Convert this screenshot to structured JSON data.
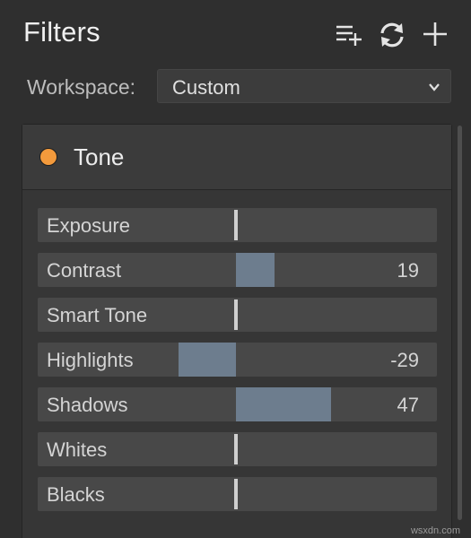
{
  "panel": {
    "title": "Filters",
    "icons": {
      "add_to_list": "playlist-add-icon",
      "sync": "sync-icon",
      "add": "plus-icon"
    }
  },
  "workspace": {
    "label": "Workspace:",
    "value": "Custom",
    "icon": "chevron-down-icon"
  },
  "section": {
    "title": "Tone",
    "indicator_color": "#f39a3c",
    "sliders": [
      {
        "label": "Exposure",
        "value": ""
      },
      {
        "label": "Contrast",
        "value": "19"
      },
      {
        "label": "Smart Tone",
        "value": ""
      },
      {
        "label": "Highlights",
        "value": "-29"
      },
      {
        "label": "Shadows",
        "value": "47"
      },
      {
        "label": "Whites",
        "value": ""
      },
      {
        "label": "Blacks",
        "value": ""
      }
    ]
  },
  "colors": {
    "accent_fill": "#6d7d8e",
    "orange_dot": "#f39a3c"
  },
  "watermark": "wsxdn.com"
}
